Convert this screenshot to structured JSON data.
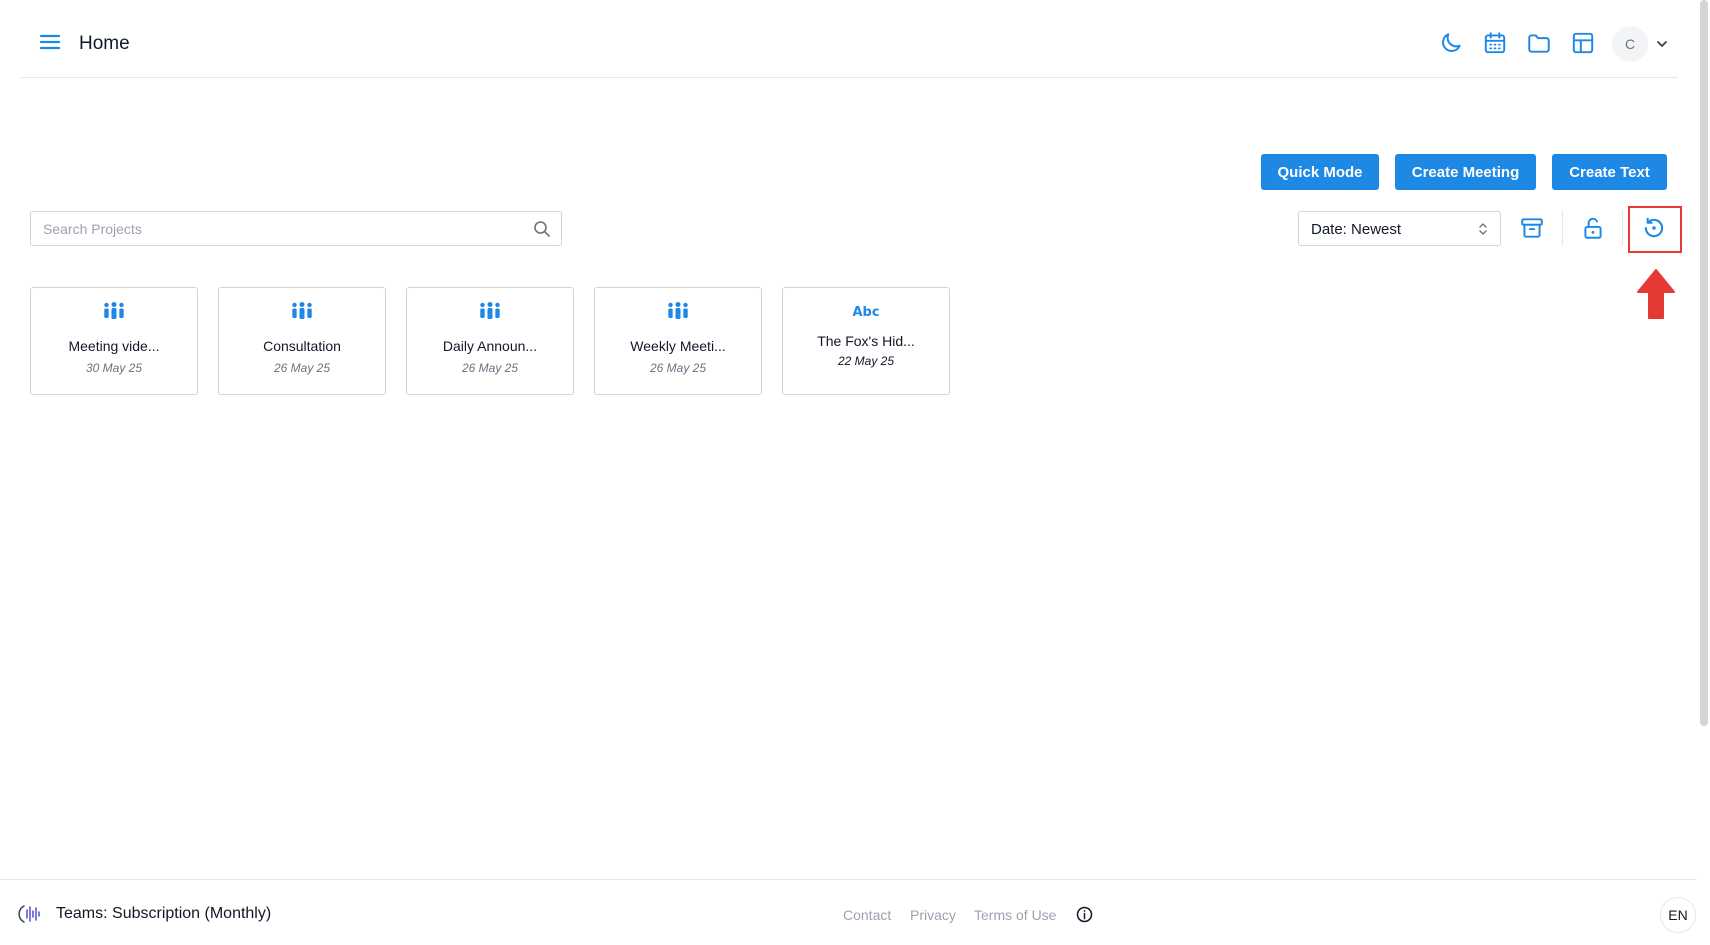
{
  "header": {
    "title": "Home",
    "icons": [
      "menu-icon",
      "moon-icon",
      "calendar-icon",
      "folder-icon",
      "layout-icon",
      "chevron-down-icon"
    ],
    "avatar_initial": "C"
  },
  "actions": {
    "quick_mode": "Quick Mode",
    "create_meeting": "Create Meeting",
    "create_text": "Create Text"
  },
  "search": {
    "placeholder": "Search Projects",
    "value": ""
  },
  "sort": {
    "selected": "Date: Newest"
  },
  "toolbar_icons": [
    "archive-icon",
    "unlock-icon",
    "history-icon"
  ],
  "projects": [
    {
      "type": "meeting",
      "title": "Meeting vide...",
      "date": "30 May 25"
    },
    {
      "type": "meeting",
      "title": "Consultation",
      "date": "26 May 25"
    },
    {
      "type": "meeting",
      "title": "Daily Announ...",
      "date": "26 May 25"
    },
    {
      "type": "meeting",
      "title": "Weekly Meeti...",
      "date": "26 May 25"
    },
    {
      "type": "text",
      "icon_text": "Abc",
      "title": "The Fox's Hid...",
      "date": "22 May 25"
    }
  ],
  "footer": {
    "plan": "Teams: Subscription (Monthly)",
    "links": [
      "Contact",
      "Privacy",
      "Terms of Use"
    ],
    "language": "EN"
  },
  "colors": {
    "accent": "#1e88e5",
    "annotation": "#e53935"
  }
}
